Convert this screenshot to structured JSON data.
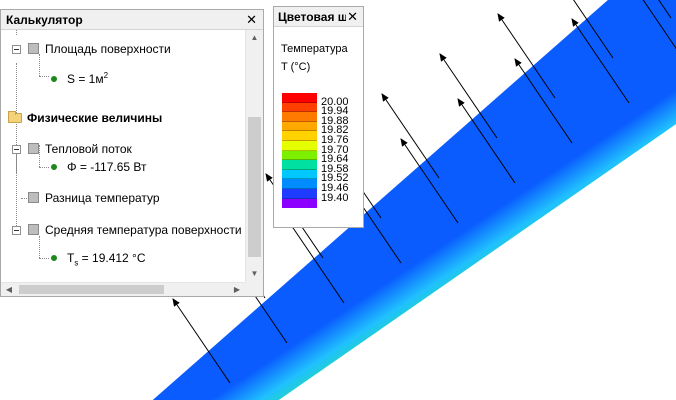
{
  "calculator": {
    "title": "Калькулятор",
    "items": [
      {
        "label": "Площадь поверхности"
      },
      {
        "value_prefix": "S = 1м",
        "value_sup": "2"
      },
      {
        "label": "Физические величины"
      },
      {
        "label": "Тепловой поток"
      },
      {
        "value": "Φ = -117.65 Вт"
      },
      {
        "label": "Разница температур"
      },
      {
        "label": "Средняя температура поверхности"
      },
      {
        "value_prefix": "T",
        "value_sub": "s",
        "value_suffix": " = 19.412 °C"
      }
    ]
  },
  "scale": {
    "title": "Цветовая ш...",
    "quantity": "Температура",
    "unit": "T (°C)",
    "labels": [
      "20.00",
      "19.94",
      "19.88",
      "19.82",
      "19.76",
      "19.70",
      "19.64",
      "19.58",
      "19.52",
      "19.46",
      "19.40"
    ],
    "colors": [
      "#ff0000",
      "#ff4000",
      "#ff7a00",
      "#ffa800",
      "#ffd200",
      "#e6ff00",
      "#7df000",
      "#00e0a0",
      "#00c8ff",
      "#008cff",
      "#1e3cff",
      "#8c00ff"
    ]
  },
  "icons": {
    "close": "close-icon",
    "expander": "collapse-icon",
    "folder": "folder-icon",
    "node": "node-icon",
    "value": "value-dot-icon"
  }
}
